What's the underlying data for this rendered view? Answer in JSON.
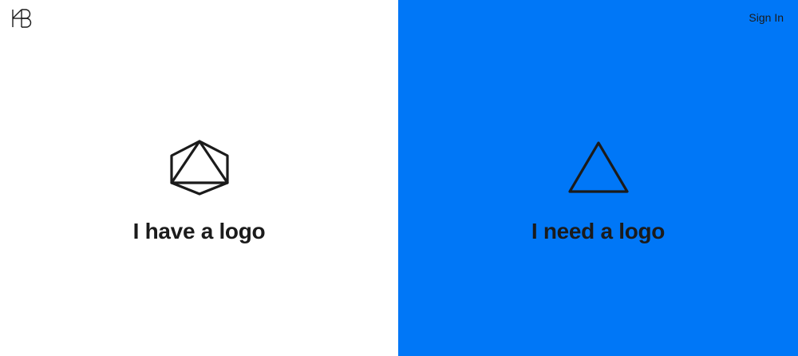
{
  "header": {
    "logo_icon": "brand-monogram-icon",
    "sign_in_label": "Sign In"
  },
  "panels": [
    {
      "title": "I have a logo",
      "icon": "hexagon-triangle-icon",
      "background": "#ffffff"
    },
    {
      "title": "I need a logo",
      "icon": "triangle-icon",
      "background": "#0077f7"
    }
  ],
  "colors": {
    "accent_blue": "#0077f7",
    "ink": "#1b1b1b"
  }
}
